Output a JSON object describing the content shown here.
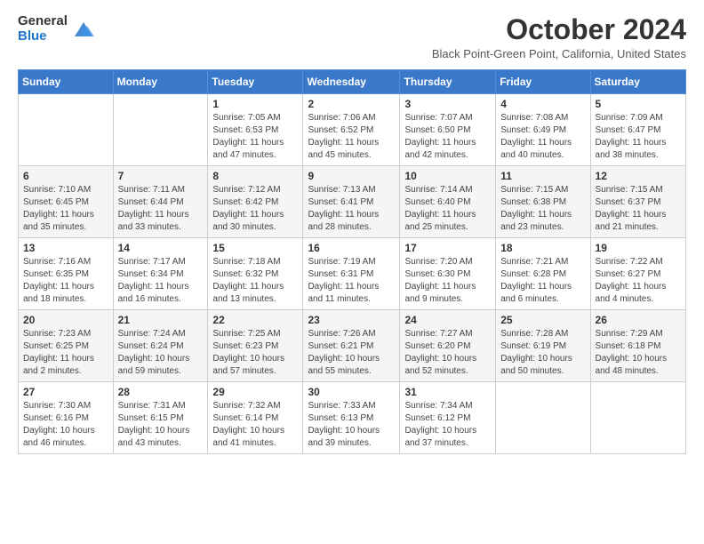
{
  "header": {
    "logo_general": "General",
    "logo_blue": "Blue",
    "month_title": "October 2024",
    "location": "Black Point-Green Point, California, United States"
  },
  "weekdays": [
    "Sunday",
    "Monday",
    "Tuesday",
    "Wednesday",
    "Thursday",
    "Friday",
    "Saturday"
  ],
  "weeks": [
    [
      {
        "day": "",
        "info": ""
      },
      {
        "day": "",
        "info": ""
      },
      {
        "day": "1",
        "info": "Sunrise: 7:05 AM\nSunset: 6:53 PM\nDaylight: 11 hours and 47 minutes."
      },
      {
        "day": "2",
        "info": "Sunrise: 7:06 AM\nSunset: 6:52 PM\nDaylight: 11 hours and 45 minutes."
      },
      {
        "day": "3",
        "info": "Sunrise: 7:07 AM\nSunset: 6:50 PM\nDaylight: 11 hours and 42 minutes."
      },
      {
        "day": "4",
        "info": "Sunrise: 7:08 AM\nSunset: 6:49 PM\nDaylight: 11 hours and 40 minutes."
      },
      {
        "day": "5",
        "info": "Sunrise: 7:09 AM\nSunset: 6:47 PM\nDaylight: 11 hours and 38 minutes."
      }
    ],
    [
      {
        "day": "6",
        "info": "Sunrise: 7:10 AM\nSunset: 6:45 PM\nDaylight: 11 hours and 35 minutes."
      },
      {
        "day": "7",
        "info": "Sunrise: 7:11 AM\nSunset: 6:44 PM\nDaylight: 11 hours and 33 minutes."
      },
      {
        "day": "8",
        "info": "Sunrise: 7:12 AM\nSunset: 6:42 PM\nDaylight: 11 hours and 30 minutes."
      },
      {
        "day": "9",
        "info": "Sunrise: 7:13 AM\nSunset: 6:41 PM\nDaylight: 11 hours and 28 minutes."
      },
      {
        "day": "10",
        "info": "Sunrise: 7:14 AM\nSunset: 6:40 PM\nDaylight: 11 hours and 25 minutes."
      },
      {
        "day": "11",
        "info": "Sunrise: 7:15 AM\nSunset: 6:38 PM\nDaylight: 11 hours and 23 minutes."
      },
      {
        "day": "12",
        "info": "Sunrise: 7:15 AM\nSunset: 6:37 PM\nDaylight: 11 hours and 21 minutes."
      }
    ],
    [
      {
        "day": "13",
        "info": "Sunrise: 7:16 AM\nSunset: 6:35 PM\nDaylight: 11 hours and 18 minutes."
      },
      {
        "day": "14",
        "info": "Sunrise: 7:17 AM\nSunset: 6:34 PM\nDaylight: 11 hours and 16 minutes."
      },
      {
        "day": "15",
        "info": "Sunrise: 7:18 AM\nSunset: 6:32 PM\nDaylight: 11 hours and 13 minutes."
      },
      {
        "day": "16",
        "info": "Sunrise: 7:19 AM\nSunset: 6:31 PM\nDaylight: 11 hours and 11 minutes."
      },
      {
        "day": "17",
        "info": "Sunrise: 7:20 AM\nSunset: 6:30 PM\nDaylight: 11 hours and 9 minutes."
      },
      {
        "day": "18",
        "info": "Sunrise: 7:21 AM\nSunset: 6:28 PM\nDaylight: 11 hours and 6 minutes."
      },
      {
        "day": "19",
        "info": "Sunrise: 7:22 AM\nSunset: 6:27 PM\nDaylight: 11 hours and 4 minutes."
      }
    ],
    [
      {
        "day": "20",
        "info": "Sunrise: 7:23 AM\nSunset: 6:25 PM\nDaylight: 11 hours and 2 minutes."
      },
      {
        "day": "21",
        "info": "Sunrise: 7:24 AM\nSunset: 6:24 PM\nDaylight: 10 hours and 59 minutes."
      },
      {
        "day": "22",
        "info": "Sunrise: 7:25 AM\nSunset: 6:23 PM\nDaylight: 10 hours and 57 minutes."
      },
      {
        "day": "23",
        "info": "Sunrise: 7:26 AM\nSunset: 6:21 PM\nDaylight: 10 hours and 55 minutes."
      },
      {
        "day": "24",
        "info": "Sunrise: 7:27 AM\nSunset: 6:20 PM\nDaylight: 10 hours and 52 minutes."
      },
      {
        "day": "25",
        "info": "Sunrise: 7:28 AM\nSunset: 6:19 PM\nDaylight: 10 hours and 50 minutes."
      },
      {
        "day": "26",
        "info": "Sunrise: 7:29 AM\nSunset: 6:18 PM\nDaylight: 10 hours and 48 minutes."
      }
    ],
    [
      {
        "day": "27",
        "info": "Sunrise: 7:30 AM\nSunset: 6:16 PM\nDaylight: 10 hours and 46 minutes."
      },
      {
        "day": "28",
        "info": "Sunrise: 7:31 AM\nSunset: 6:15 PM\nDaylight: 10 hours and 43 minutes."
      },
      {
        "day": "29",
        "info": "Sunrise: 7:32 AM\nSunset: 6:14 PM\nDaylight: 10 hours and 41 minutes."
      },
      {
        "day": "30",
        "info": "Sunrise: 7:33 AM\nSunset: 6:13 PM\nDaylight: 10 hours and 39 minutes."
      },
      {
        "day": "31",
        "info": "Sunrise: 7:34 AM\nSunset: 6:12 PM\nDaylight: 10 hours and 37 minutes."
      },
      {
        "day": "",
        "info": ""
      },
      {
        "day": "",
        "info": ""
      }
    ]
  ]
}
